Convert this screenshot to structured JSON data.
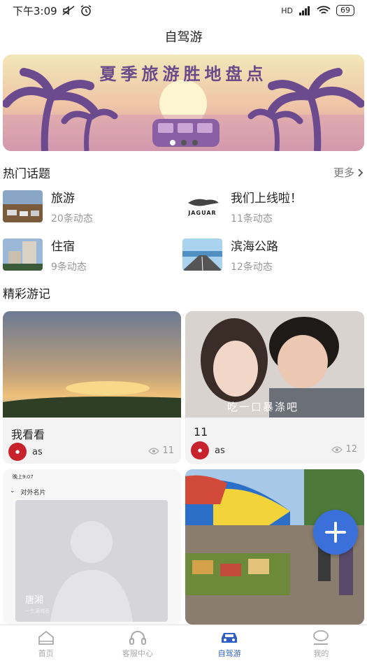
{
  "status_bar": {
    "time": "下午3:09",
    "network": "HD",
    "battery": "69"
  },
  "nav": {
    "title": "自驾游"
  },
  "banner": {
    "title": "夏季旅游胜地盘点"
  },
  "hot_topics": {
    "title": "热门话题",
    "more": "更多",
    "items": [
      {
        "name": "旅游",
        "count": "20条动态"
      },
      {
        "name": "我们上线啦！",
        "count": "11条动态",
        "logo_text": "JAGUAR"
      },
      {
        "name": "住宿",
        "count": "9条动态"
      },
      {
        "name": "滨海公路",
        "count": "12条动态"
      }
    ]
  },
  "travel_notes": {
    "title": "精彩游记",
    "cards": [
      {
        "title": "我看看",
        "author": "as",
        "views": "11"
      },
      {
        "title": "11",
        "author": "as",
        "views": "12",
        "caption": "吃一口暴涤吧"
      },
      {
        "phone_time": "晚上9:07",
        "header": "对外名片",
        "person_name": "唐湘",
        "person_sub": "一生满城香"
      },
      {}
    ]
  },
  "tabs": [
    {
      "label": "首页",
      "icon": "home-icon"
    },
    {
      "label": "客服中心",
      "icon": "headset-icon"
    },
    {
      "label": "自驾游",
      "icon": "car-icon"
    },
    {
      "label": "我的",
      "icon": "person-icon"
    }
  ],
  "colors": {
    "accent": "#2f5fc6",
    "fab": "#3b6fd9"
  }
}
